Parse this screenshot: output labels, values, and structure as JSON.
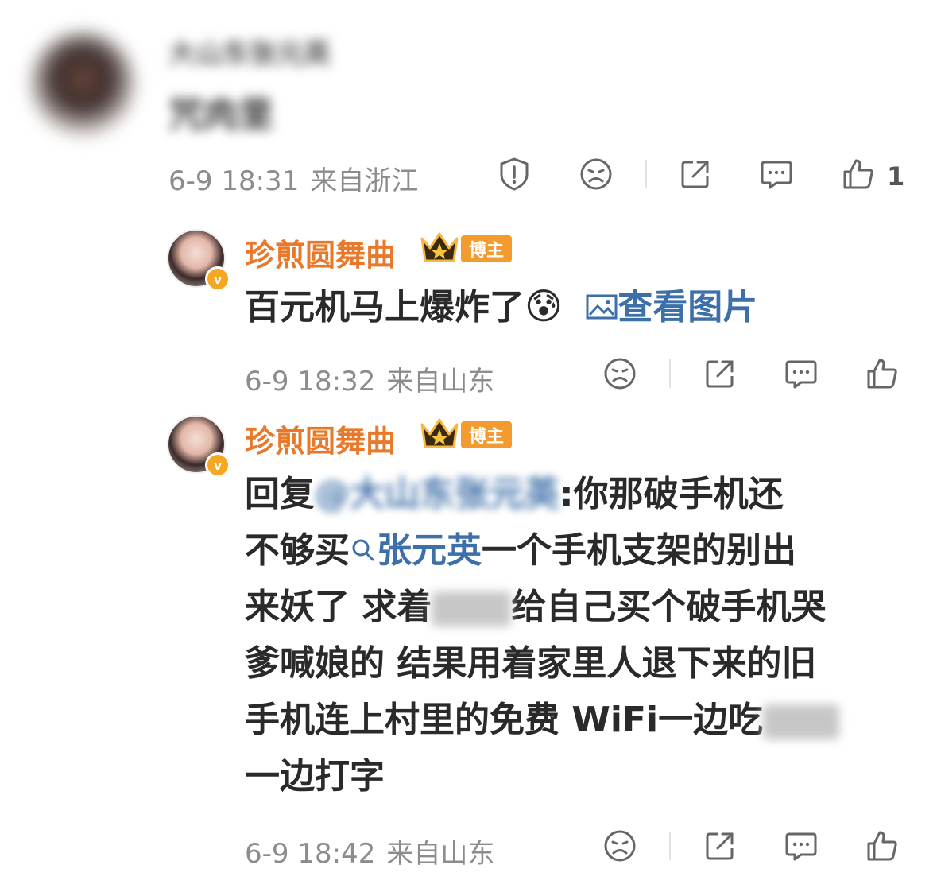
{
  "comment": {
    "user_name": "大山东张元英",
    "text": "咒肉里",
    "time": "6-9 18:31",
    "location": "来自浙江",
    "like_count": "1"
  },
  "replies": [
    {
      "user_name": "珍煎圆舞曲",
      "badge": "博主",
      "text": "百元机马上爆炸了",
      "emoji": "😰",
      "view_image": "查看图片",
      "time": "6-9 18:32",
      "location": "来自山东"
    },
    {
      "user_name": "珍煎圆舞曲",
      "badge": "博主",
      "reply_prefix": "回复",
      "mention": "@大山东张元英",
      "line1_rest": ":你那破手机还",
      "line2_start": "不够买",
      "topic": "张元英",
      "line2_rest": "一个手机支架的别出",
      "line3_start": "来妖了 求着",
      "line3_rest": "给自己买个破手机哭",
      "line4": "爹喊娘的 结果用着家里人退下来的旧",
      "line5": "手机连上村里的免费 WiFi一边吃",
      "line6": "一边打字",
      "time": "6-9 18:42",
      "location": "来自山东"
    }
  ],
  "colors": {
    "name": "#e8792a",
    "link": "#3d6fa8",
    "meta": "#8c8c8c",
    "badge": "#f39b2e"
  },
  "icons": [
    "report-icon",
    "dislike-icon",
    "share-icon",
    "comment-icon",
    "like-icon",
    "crown-icon",
    "image-icon",
    "search-icon"
  ]
}
